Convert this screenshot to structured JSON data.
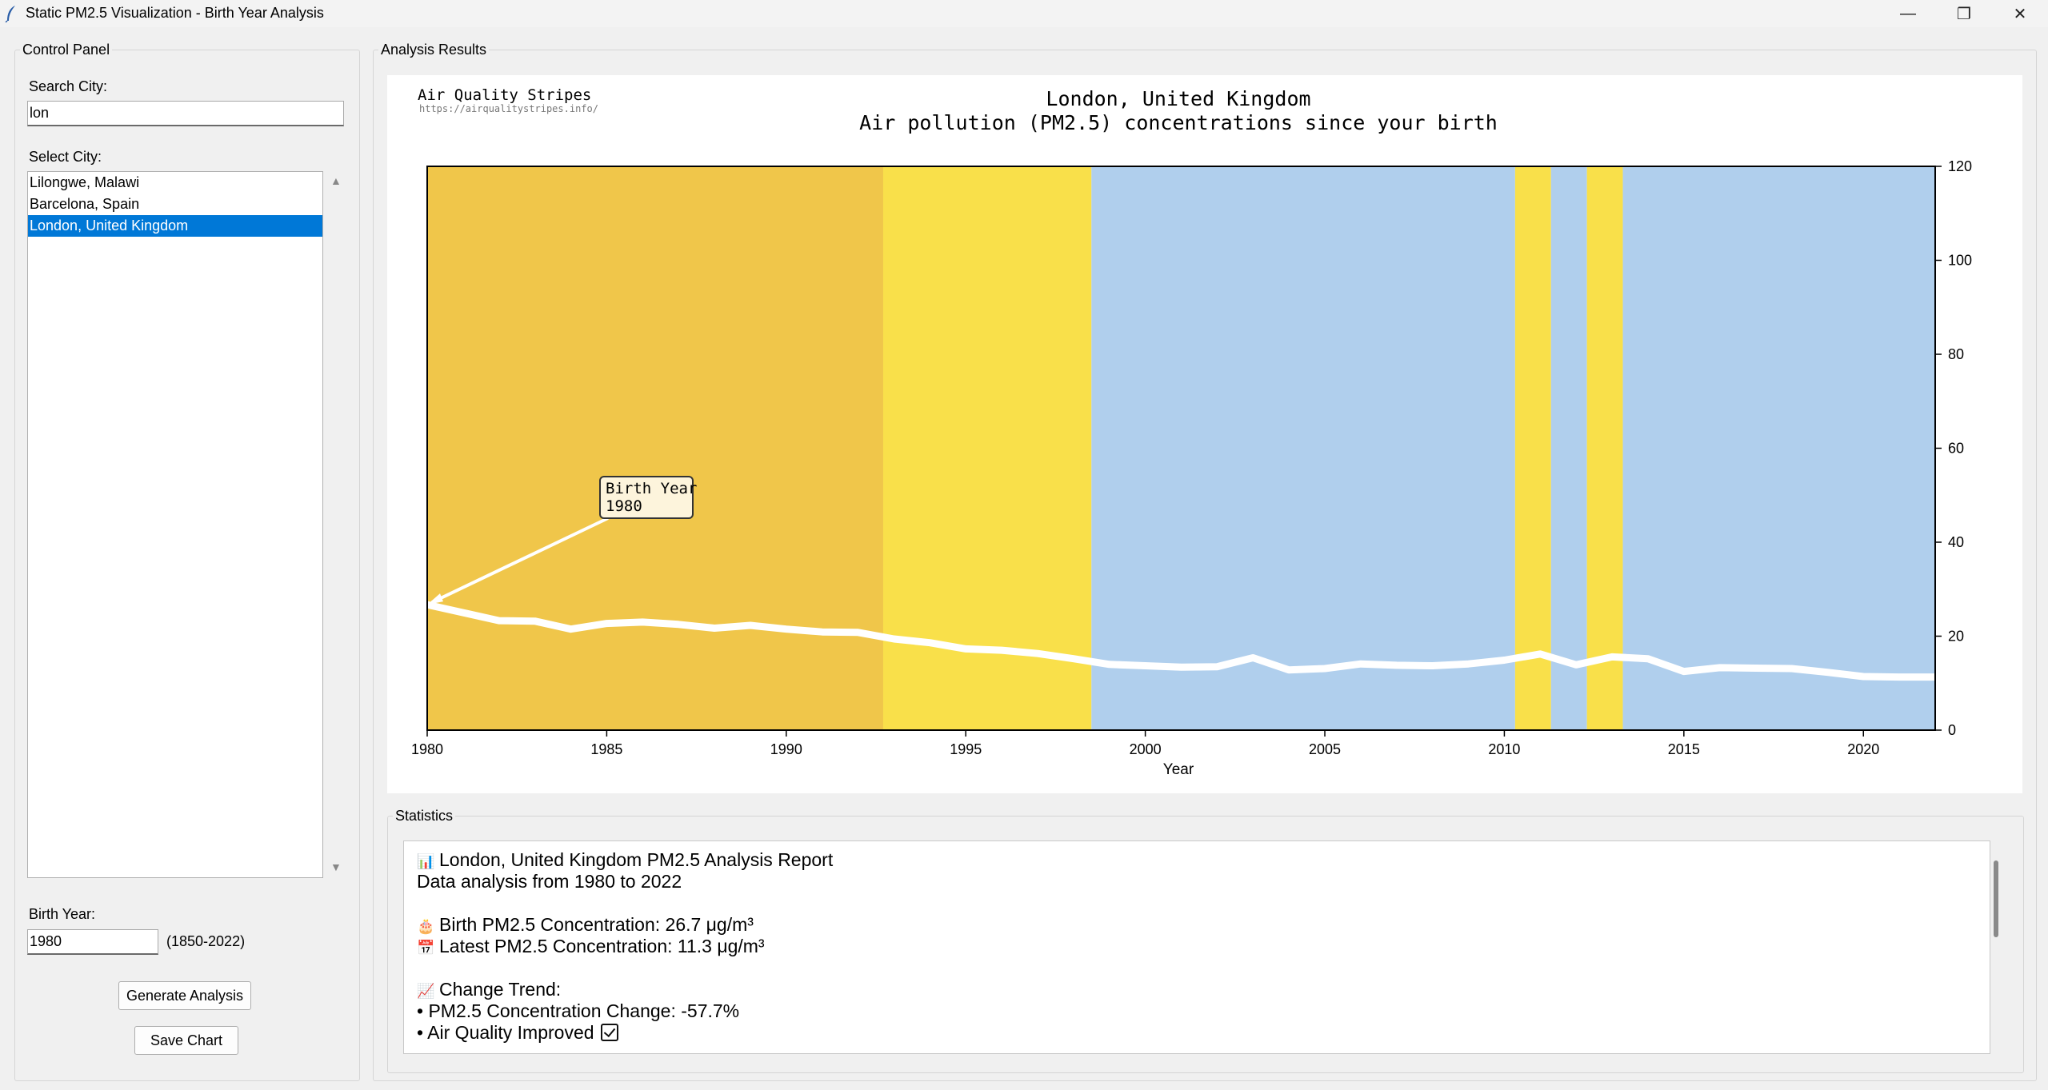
{
  "window": {
    "title": "Static PM2.5 Visualization - Birth Year Analysis",
    "controls": {
      "minimize": "—",
      "restore": "❐",
      "close": "✕"
    }
  },
  "control_panel": {
    "title": "Control Panel",
    "search_label": "Search City:",
    "search_value": "lon",
    "select_label": "Select City:",
    "cities": [
      {
        "name": "Lilongwe, Malawi",
        "selected": false
      },
      {
        "name": "Barcelona, Spain",
        "selected": false
      },
      {
        "name": "London, United Kingdom",
        "selected": true
      }
    ],
    "birth_year_label": "Birth Year:",
    "birth_year_value": "1980",
    "birth_year_range": "(1850-2022)",
    "generate_button": "Generate Analysis",
    "save_button": "Save Chart"
  },
  "results": {
    "title": "Analysis Results"
  },
  "chart_data": {
    "type": "line",
    "brand": "Air Quality Stripes",
    "url": "https://airqualitystripes.info/",
    "title": "London, United Kingdom",
    "subtitle": "Air pollution (PM2.5) concentrations since your birth",
    "xlabel": "Year",
    "ylabel": "",
    "xlim": [
      1980,
      2022
    ],
    "ylim": [
      0,
      120
    ],
    "x_ticks": [
      1980,
      1985,
      1990,
      1995,
      2000,
      2005,
      2010,
      2015,
      2020
    ],
    "y_ticks": [
      0,
      20,
      40,
      60,
      80,
      100,
      120
    ],
    "y_axis_side": "right",
    "grid": false,
    "legend": "none",
    "line_color": "#ffffff",
    "series": [
      {
        "x": [
          1980,
          1981,
          1982,
          1983,
          1984,
          1985,
          1986,
          1987,
          1988,
          1989,
          1990,
          1991,
          1992,
          1993,
          1994,
          1995,
          1996,
          1997,
          1998,
          1999,
          2000,
          2001,
          2002,
          2003,
          2004,
          2005,
          2006,
          2007,
          2008,
          2009,
          2010,
          2011,
          2012,
          2013,
          2014,
          2015,
          2016,
          2017,
          2018,
          2019,
          2020,
          2021,
          2022
        ],
        "values": [
          26.7,
          25.0,
          23.3,
          23.2,
          21.5,
          22.7,
          23.0,
          22.5,
          21.7,
          22.3,
          21.5,
          20.9,
          20.8,
          19.4,
          18.6,
          17.3,
          17.0,
          16.3,
          15.2,
          14.0,
          13.7,
          13.4,
          13.5,
          15.4,
          12.8,
          13.1,
          14.1,
          13.8,
          13.7,
          14.1,
          14.9,
          16.2,
          13.9,
          15.6,
          15.2,
          12.5,
          13.3,
          13.2,
          13.1,
          12.3,
          11.4,
          11.3,
          11.3
        ]
      }
    ],
    "stripes": [
      {
        "from": 1980,
        "to": 1992.7,
        "color": "#f0c64a"
      },
      {
        "from": 1992.7,
        "to": 1998.5,
        "color": "#f9e04a"
      },
      {
        "from": 1998.5,
        "to": 2010.3,
        "color": "#b0cfed"
      },
      {
        "from": 2010.3,
        "to": 2011.3,
        "color": "#f9e04a"
      },
      {
        "from": 2011.3,
        "to": 2012.3,
        "color": "#b0cfed"
      },
      {
        "from": 2012.3,
        "to": 2013.3,
        "color": "#f9e04a"
      },
      {
        "from": 2013.3,
        "to": 2022,
        "color": "#b0cfed"
      }
    ],
    "annotation": {
      "line1": "Birth Year",
      "line2": "1980",
      "x": 1980,
      "y": 26.7
    }
  },
  "statistics": {
    "title": "Statistics",
    "lines": [
      {
        "icon": "📊",
        "icon_name": "bar-chart-icon",
        "text": "London, United Kingdom PM2.5 Analysis Report"
      },
      {
        "icon": "",
        "icon_name": "",
        "text": "Data analysis from 1980 to 2022"
      },
      {
        "icon": "",
        "icon_name": "",
        "text": ""
      },
      {
        "icon": "🎂",
        "icon_name": "birthday-cake-icon",
        "text": "Birth PM2.5 Concentration: 26.7 μg/m³"
      },
      {
        "icon": "📅",
        "icon_name": "calendar-icon",
        "text": "Latest PM2.5 Concentration: 11.3 μg/m³"
      },
      {
        "icon": "",
        "icon_name": "",
        "text": ""
      },
      {
        "icon": "📈",
        "icon_name": "trend-chart-icon",
        "text": "Change Trend:"
      },
      {
        "icon": "",
        "icon_name": "",
        "text": "• PM2.5 Concentration Change: -57.7%"
      },
      {
        "icon": "",
        "icon_name": "",
        "text": "• Air Quality Improved",
        "check": true
      }
    ]
  }
}
